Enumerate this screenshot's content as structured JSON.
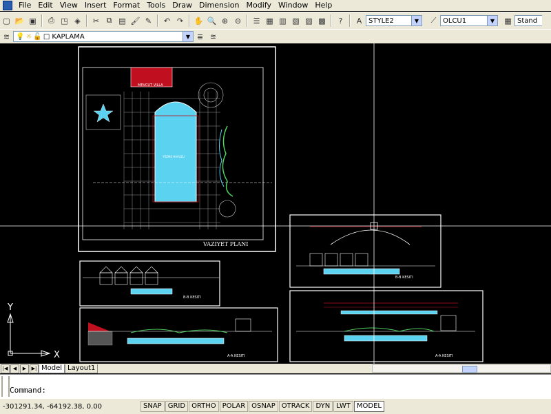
{
  "menubar": {
    "items": [
      "File",
      "Edit",
      "View",
      "Insert",
      "Format",
      "Tools",
      "Draw",
      "Dimension",
      "Modify",
      "Window",
      "Help"
    ]
  },
  "toolbar": {
    "text_style": "STYLE2",
    "dim_style": "OLCU1",
    "table_style": "Stand"
  },
  "layers": {
    "current_layer": "KAPLAMA"
  },
  "drawing": {
    "plan_title": "VAZIYET PLANI",
    "villa_label": "MEVCUT VILLA",
    "pool_label": "YÜZME HAVUZU",
    "section_bb": "B-B KESITI",
    "section_bb2": "B-B KESITI",
    "section_aa": "A-A KESITI",
    "section_aa2": "A-A KESITI",
    "ucs_y": "Y",
    "ucs_x": "X"
  },
  "tabs": {
    "model": "Model",
    "layout1": "Layout1"
  },
  "command": {
    "prompt": "Command:"
  },
  "status": {
    "coords": "-301291.34, -64192.38, 0.00",
    "buttons": [
      "SNAP",
      "GRID",
      "ORTHO",
      "POLAR",
      "OSNAP",
      "OTRACK",
      "DYN",
      "LWT",
      "MODEL"
    ]
  },
  "colors": {
    "background": "#000000",
    "accent_red": "#c01020",
    "pool_cyan": "#5ad2f0",
    "ui_face": "#ece9d8"
  }
}
